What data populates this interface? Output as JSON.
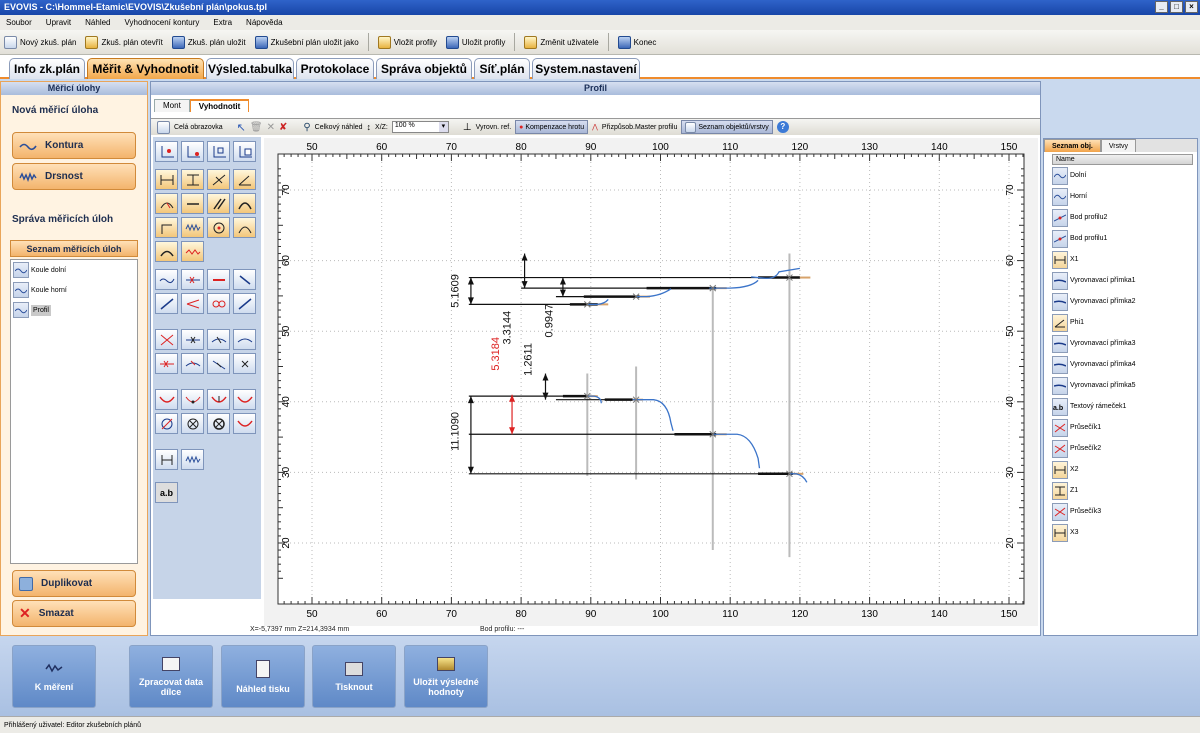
{
  "window": {
    "title": "EVOVIS - C:\\Hommel-Etamic\\EVOVIS\\Zkušební plán\\pokus.tpl"
  },
  "menu": [
    "Soubor",
    "Upravit",
    "Náhled",
    "Vyhodnocení kontury",
    "Extra",
    "Nápověda"
  ],
  "toolbar": [
    "Nový zkuš. plán",
    "Zkuš. plán otevřít",
    "Zkuš. plán uložit",
    "Zkušební plán uložit jako",
    "Vložit profily",
    "Uložit profily",
    "Změnit uživatele",
    "Konec"
  ],
  "tabs": [
    "Info zk.plán",
    "Měřit & Vyhodnotit",
    "Výsled.tabulka",
    "Protokolace",
    "Správa objektů",
    "Síť.plán",
    "System.nastavení"
  ],
  "left": {
    "header": "Měřicí úlohy",
    "new_task": "Nová měřicí úloha",
    "kontura": "Kontura",
    "drsnost": "Drsnost",
    "manage": "Správa měřicích úloh",
    "list_header": "Seznam měřicích úloh",
    "list": [
      "Koule dolní",
      "Koule horní",
      "Profil"
    ],
    "duplicate": "Duplikovat",
    "delete": "Smazat"
  },
  "center": {
    "header": "Profil",
    "subtabs": [
      "Mont",
      "Vyhodnotit"
    ],
    "full_screen": "Celá obrazovka",
    "overview": "Celkový náhled",
    "xz_label": "X/Z:",
    "zoom": "100 %",
    "align_ref": "Vyrovn. ref.",
    "tip_comp": "Kompenzace hrotu",
    "master": "Přizpůsob.Master profilu",
    "obj_list": "Seznam objektů/vrstvy",
    "coords": "X=-5,7397 mm Z=214,3934 mm",
    "point": "Bod profilu: ---"
  },
  "plot": {
    "x_ticks": [
      "50",
      "60",
      "70",
      "80",
      "90",
      "100",
      "110",
      "120",
      "130",
      "140",
      "150"
    ],
    "y_ticks": [
      "70",
      "60",
      "50",
      "40",
      "30",
      "20"
    ],
    "dims": [
      "5.1609",
      "3.3144",
      "0.9947",
      "1.2611",
      "5.3184",
      "11.1090"
    ]
  },
  "right": {
    "tabs": [
      "Seznam obj.",
      "Vrstvy"
    ],
    "col": "Name",
    "items": [
      "Dolní",
      "Horní",
      "Bod profilu2",
      "Bod profilu1",
      "X1",
      "Vyrovnavací přímka1",
      "Vyrovnavací přímka2",
      "Phi1",
      "Vyrovnavací přímka3",
      "Vyrovnavací přímka4",
      "Vyrovnavací přímka5",
      "Textový rámeček1",
      "Průsečík1",
      "Průsečík2",
      "X2",
      "Z1",
      "Průsečík3",
      "X3"
    ]
  },
  "bottom": [
    "K měření",
    "Zpracovat data dílce",
    "Náhled tisku",
    "Tisknout",
    "Uložit výsledné hodnoty"
  ],
  "status": {
    "user_label": "Přihlášený uživatel:",
    "user": "Editor zkušebních plánů"
  }
}
